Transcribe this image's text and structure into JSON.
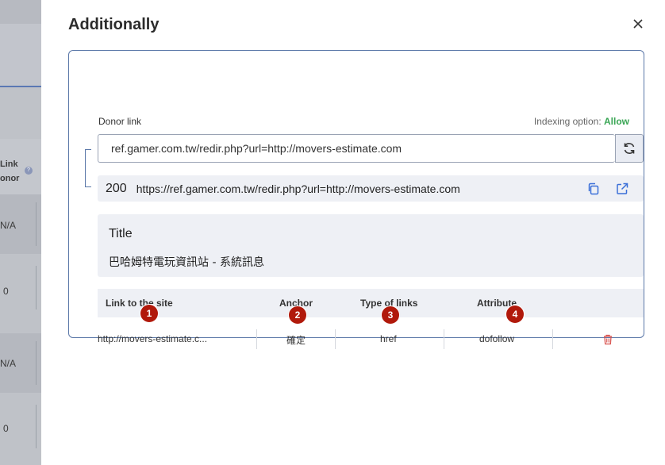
{
  "background": {
    "header_line1": "Link",
    "header_line2": "onor",
    "help": "?",
    "cells": [
      "N/A",
      "0",
      "N/A",
      "0"
    ]
  },
  "modal": {
    "title": "Additionally",
    "close_icon": "close-icon"
  },
  "donor": {
    "label": "Donor link",
    "indexing_label": "Indexing option:",
    "indexing_value": "Allow",
    "input_value": "ref.gamer.com.tw/redir.php?url=http://movers-estimate.com",
    "refresh_icon": "refresh-icon"
  },
  "result": {
    "status": "200",
    "url": "https://ref.gamer.com.tw/redir.php?url=http://movers-estimate.com",
    "copy_icon": "copy-icon",
    "open_icon": "external-link-icon"
  },
  "title_box": {
    "label": "Title",
    "value": "巴哈姆特電玩資訊站 - 系統訊息"
  },
  "table": {
    "headers": [
      "Link to the site",
      "Anchor",
      "Type of links",
      "Attribute"
    ],
    "row": {
      "link": "http://movers-estimate.c...",
      "anchor": "確定",
      "type": "href",
      "attribute": "dofollow"
    },
    "delete_icon": "trash-icon"
  },
  "badges": [
    "1",
    "2",
    "3",
    "4"
  ],
  "colors": {
    "allow": "#3aa655",
    "accent_border": "#5a77a8",
    "badge": "#b1190b",
    "delete": "#d9534f"
  }
}
